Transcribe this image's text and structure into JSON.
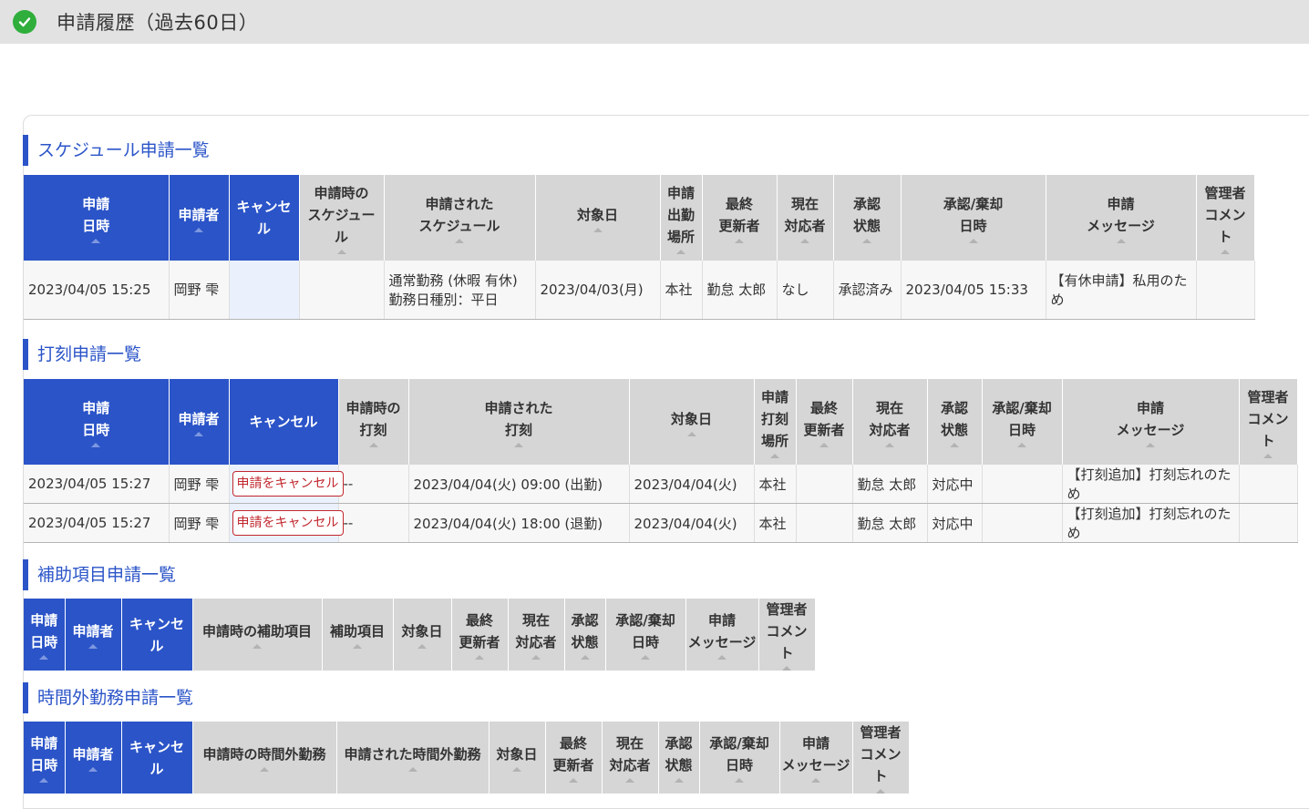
{
  "header": {
    "title": "申請履歴（過去60日）",
    "icon": "check-circle-icon",
    "icon_color": "#2fae3c"
  },
  "colors": {
    "accent": "#2b54c8",
    "header_gray": "#d6d6d6",
    "danger": "#c1272d"
  },
  "sections": {
    "schedule": {
      "title": "スケジュール申請一覧",
      "columns": [
        "申請\n日時",
        "申請者",
        "キャンセル",
        "申請時の\nスケジュール",
        "申請された\nスケジュール",
        "対象日",
        "申請\n出勤\n場所",
        "最終\n更新者",
        "現在\n対応者",
        "承認\n状態",
        "承認/棄却\n日時",
        "申請\nメッセージ",
        "管理者\nコメント"
      ],
      "rows": [
        [
          "2023/04/05 15:25",
          "岡野 雫",
          "",
          "",
          "通常勤務 (休暇 有休)\n勤務日種別：平日",
          "2023/04/03(月)",
          "本社",
          "勤怠 太郎",
          "なし",
          "承認済み",
          "2023/04/05 15:33",
          "【有休申請】私用のため",
          ""
        ]
      ]
    },
    "punch": {
      "title": "打刻申請一覧",
      "columns": [
        "申請\n日時",
        "申請者",
        "キャンセル",
        "申請時の\n打刻",
        "申請された\n打刻",
        "対象日",
        "申請\n打刻\n場所",
        "最終\n更新者",
        "現在\n対応者",
        "承認\n状態",
        "承認/棄却\n日時",
        "申請\nメッセージ",
        "管理者\nコメント"
      ],
      "rows": [
        [
          "2023/04/05 15:27",
          "岡野 雫",
          "申請をキャンセル",
          "--",
          "2023/04/04(火) 09:00 (出勤)",
          "2023/04/04(火)",
          "本社",
          "",
          "勤怠 太郎",
          "対応中",
          "",
          "【打刻追加】打刻忘れのため",
          ""
        ],
        [
          "2023/04/05 15:27",
          "岡野 雫",
          "申請をキャンセル",
          "--",
          "2023/04/04(火) 18:00 (退勤)",
          "2023/04/04(火)",
          "本社",
          "",
          "勤怠 太郎",
          "対応中",
          "",
          "【打刻追加】打刻忘れのため",
          ""
        ]
      ]
    },
    "aux": {
      "title": "補助項目申請一覧",
      "columns": [
        "申請\n日時",
        "申請者",
        "キャンセル",
        "申請時の補助項目",
        "補助項目",
        "対象日",
        "最終\n更新者",
        "現在\n対応者",
        "承認\n状態",
        "承認/棄却\n日時",
        "申請\nメッセージ",
        "管理者\nコメント"
      ],
      "rows": []
    },
    "overtime": {
      "title": "時間外勤務申請一覧",
      "columns": [
        "申請\n日時",
        "申請者",
        "キャンセル",
        "申請時の時間外勤務",
        "申請された時間外勤務",
        "対象日",
        "最終\n更新者",
        "現在\n対応者",
        "承認\n状態",
        "承認/棄却\n日時",
        "申請\nメッセージ",
        "管理者\nコメント"
      ],
      "rows": []
    }
  }
}
